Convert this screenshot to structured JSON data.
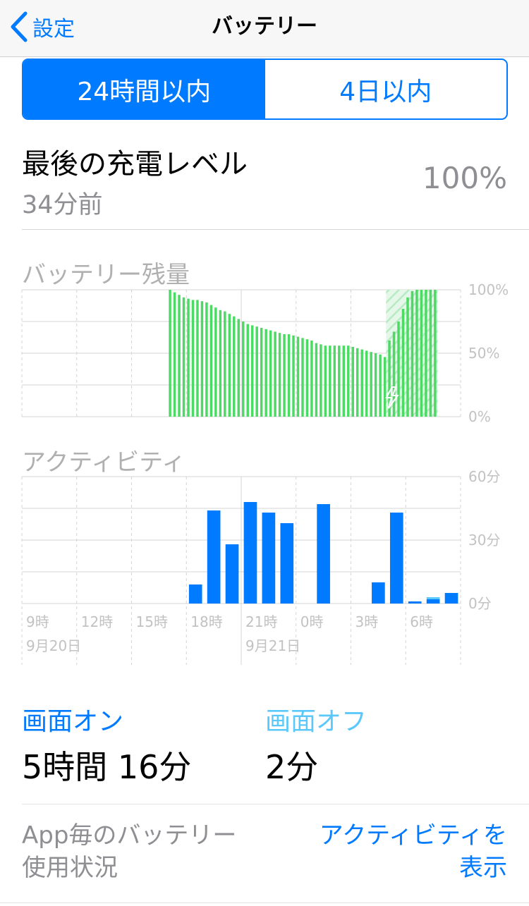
{
  "nav": {
    "back_label": "設定",
    "title": "バッテリー"
  },
  "segments": [
    {
      "label": "24時間以内",
      "active": true
    },
    {
      "label": "4日以内",
      "active": false
    }
  ],
  "last_charge": {
    "label": "最後の充電レベル",
    "time": "34分前",
    "value": "100%"
  },
  "colors": {
    "accent": "#007aff",
    "battery_green": "#4cd964",
    "screen_off": "#5ac8fa",
    "grid": "#d4d4d4"
  },
  "chart_data": [
    {
      "type": "bar",
      "title": "バッテリー残量",
      "y_ticks": [
        "100%",
        "50%",
        "0%"
      ],
      "ylim": [
        0,
        100
      ],
      "unit": "%",
      "samples_per_hour": 4,
      "first_sample_hour_index": 8,
      "values": [
        100,
        98,
        96,
        94,
        93,
        92,
        92,
        91,
        90,
        88,
        86,
        84,
        83,
        81,
        79,
        77,
        75,
        73,
        72,
        71,
        70,
        69,
        68,
        67,
        66,
        65,
        65,
        64,
        63,
        62,
        61,
        60,
        58,
        57,
        56,
        56,
        56,
        56,
        56,
        56,
        55,
        54,
        53,
        52,
        51,
        50,
        49,
        47,
        60,
        67,
        75,
        85,
        94,
        99,
        100,
        100,
        100,
        100,
        100
      ],
      "charging_start_sample": 48,
      "charging_icon": "lightning-bolt-icon"
    },
    {
      "type": "bar",
      "title": "アクティビティ",
      "y_ticks": [
        "60分",
        "30分",
        "0分"
      ],
      "ylim": [
        0,
        60
      ],
      "unit": "分",
      "x_tick_labels": [
        "9時",
        "12時",
        "15時",
        "18時",
        "21時",
        "0時",
        "3時",
        "6時"
      ],
      "date_labels": [
        "9月20日",
        "9月21日"
      ],
      "series": [
        {
          "name": "画面オン",
          "values": [
            0,
            0,
            0,
            0,
            0,
            0,
            0,
            0,
            0,
            9,
            44,
            28,
            48,
            43,
            38,
            0,
            47,
            0,
            0,
            10,
            43,
            1,
            2,
            5,
            0
          ]
        },
        {
          "name": "画面オフ",
          "values": [
            0,
            0,
            0,
            0,
            0,
            0,
            0,
            0,
            0,
            0,
            0,
            0,
            0,
            0,
            0,
            0,
            0,
            0,
            0,
            0,
            0,
            0,
            1,
            0,
            0
          ]
        }
      ]
    }
  ],
  "usage": {
    "screen_on_label": "画面オン",
    "screen_on_value": "5時間 16分",
    "screen_off_label": "画面オフ",
    "screen_off_value": "2分"
  },
  "per_app": {
    "label_line1": "App毎のバッテリー",
    "label_line2": "使用状況",
    "link_line1": "アクティビティを",
    "link_line2": "表示"
  }
}
